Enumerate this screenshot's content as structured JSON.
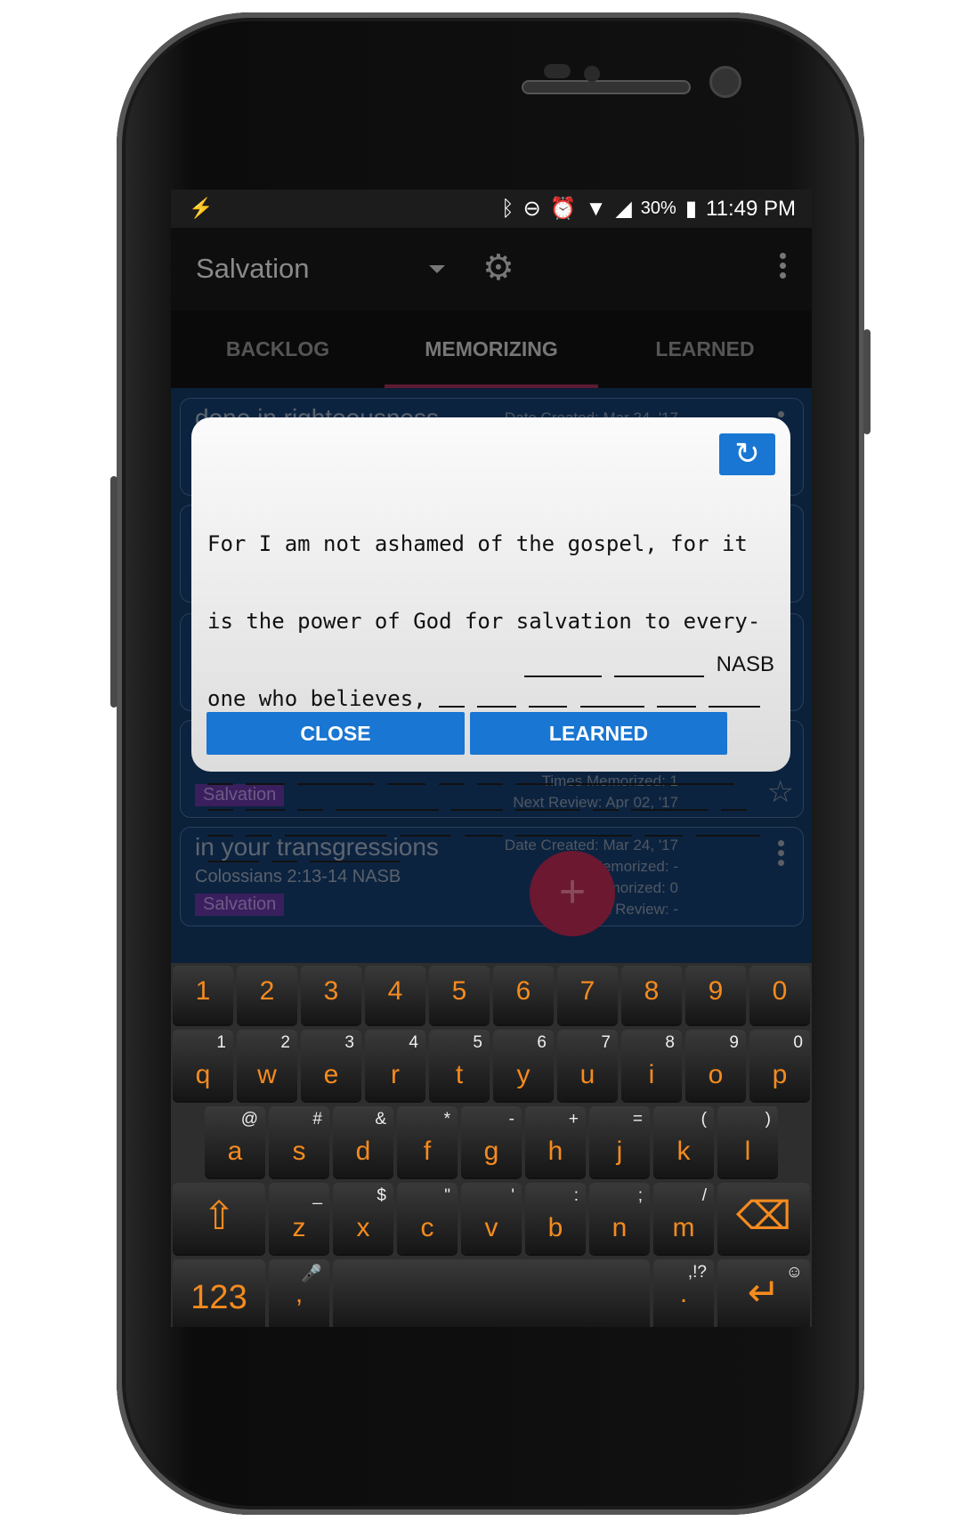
{
  "status_bar": {
    "charging_icon": "lightning-bolt",
    "icons": [
      "bluetooth",
      "do-not-disturb",
      "alarm",
      "wifi",
      "cell-signal",
      "battery-charging"
    ],
    "battery": "30%",
    "time": "11:49 PM"
  },
  "toolbar": {
    "title": "Salvation",
    "dropdown_icon": "caret-down",
    "settings_icon": "gear",
    "menu_icon": "more-vert"
  },
  "tabs": [
    {
      "label": "BACKLOG",
      "active": false
    },
    {
      "label": "MEMORIZING",
      "active": true
    },
    {
      "label": "LEARNED",
      "active": false
    }
  ],
  "cards": [
    {
      "title": "done in righteousness",
      "date_created": "Date Created: Mar 24, '17"
    },
    {
      "tag": "Salvation",
      "times_memorized": "Times Memorized: 1",
      "next_review": "Next Review: Apr 02, '17"
    },
    {
      "title": "in your transgressions",
      "reference": "Colossians 2:13-14  NASB",
      "tag": "Salvation",
      "date_created": "Date Created: Mar 24, '17",
      "last_memorized": "Last Memorized: -",
      "times_memorized": "Times Memorized: 0",
      "next_review": "Next Review: -"
    }
  ],
  "fab": {
    "label": "+"
  },
  "dialog": {
    "refresh_icon": "refresh",
    "verse_lines": [
      "For I am not ashamed of the gospel, for it",
      "is the power of God for salvation to every-",
      "one who believes, "
    ],
    "blank_words": [
      [
        2,
        3,
        3,
        5,
        3,
        4
      ],
      [
        2,
        3,
        6,
        3,
        2,
        2,
        3,
        13
      ],
      [
        2,
        3,
        2,
        8,
        4,
        5,
        2,
        6,
        2
      ],
      [
        2,
        2,
        8,
        4,
        3,
        9,
        3,
        5
      ],
      [
        4,
        2,
        7
      ]
    ],
    "reference_blanks": [
      6,
      7
    ],
    "translation": "NASB",
    "close_label": "CLOSE",
    "learned_label": "LEARNED"
  },
  "keyboard": {
    "accent": "#f58b1f",
    "rows": [
      [
        [
          "1",
          ""
        ],
        [
          "2",
          ""
        ],
        [
          "3",
          ""
        ],
        [
          "4",
          ""
        ],
        [
          "5",
          ""
        ],
        [
          "6",
          ""
        ],
        [
          "7",
          ""
        ],
        [
          "8",
          ""
        ],
        [
          "9",
          ""
        ],
        [
          "0",
          ""
        ]
      ],
      [
        [
          "q",
          "1"
        ],
        [
          "w",
          "2"
        ],
        [
          "e",
          "3"
        ],
        [
          "r",
          "4"
        ],
        [
          "t",
          "5"
        ],
        [
          "y",
          "6"
        ],
        [
          "u",
          "7"
        ],
        [
          "i",
          "8"
        ],
        [
          "o",
          "9"
        ],
        [
          "p",
          "0"
        ]
      ],
      [
        [
          "a",
          "@"
        ],
        [
          "s",
          "#"
        ],
        [
          "d",
          "&"
        ],
        [
          "f",
          "*"
        ],
        [
          "g",
          "-"
        ],
        [
          "h",
          "+"
        ],
        [
          "j",
          "="
        ],
        [
          "k",
          "("
        ],
        [
          "l",
          ")"
        ]
      ],
      [
        [
          "⇧",
          ""
        ],
        [
          "z",
          "_"
        ],
        [
          "x",
          "$"
        ],
        [
          "c",
          "\""
        ],
        [
          "v",
          "'"
        ],
        [
          "b",
          ":"
        ],
        [
          "n",
          ";"
        ],
        [
          "m",
          "/"
        ],
        [
          "⌫",
          ""
        ]
      ],
      [
        [
          "123",
          ""
        ],
        [
          ",",
          "🎤"
        ],
        [
          "",
          ""
        ],
        [
          ".",
          ",!?"
        ],
        [
          "↵",
          "☺"
        ]
      ]
    ]
  }
}
